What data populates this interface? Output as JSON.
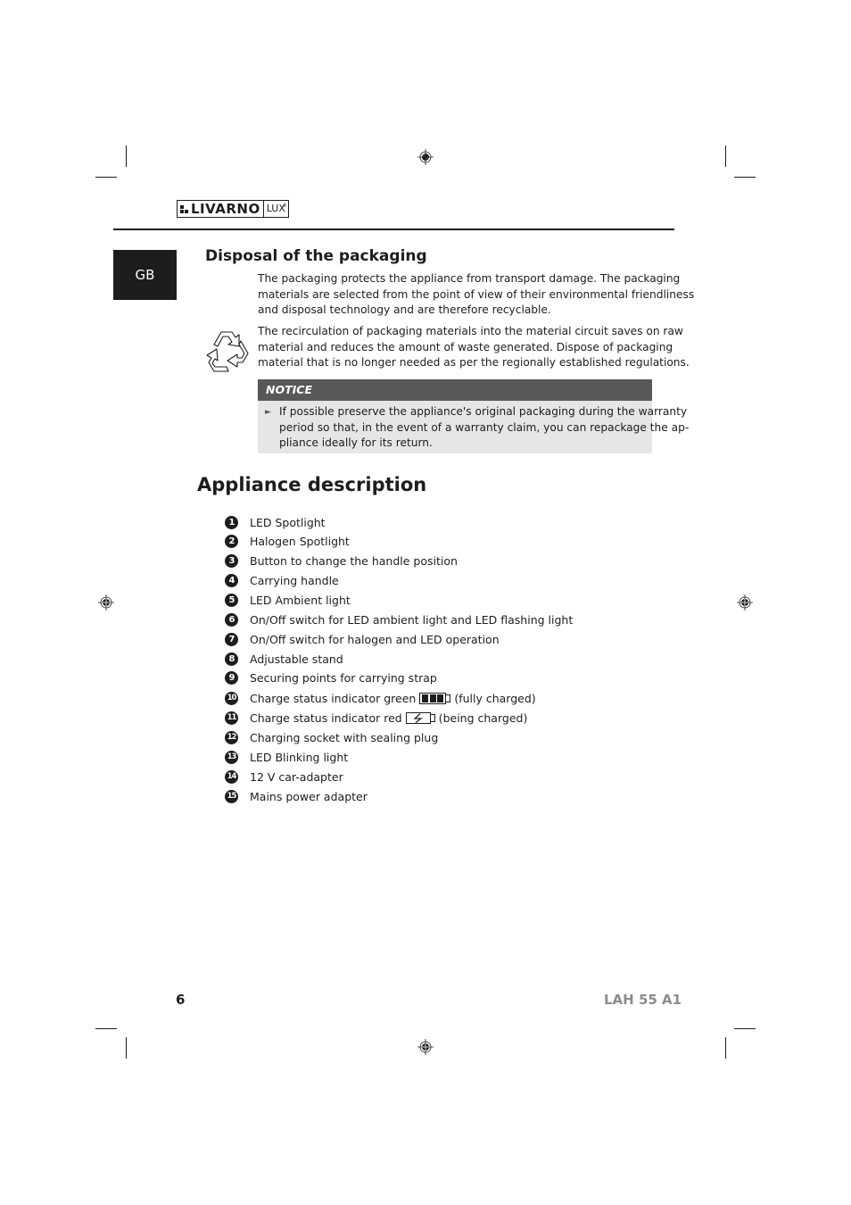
{
  "header": {
    "brand": "LIVARNO",
    "brand_sub": "LUX",
    "brand_reg": "®",
    "language_tab": "GB"
  },
  "disposal": {
    "title": "Disposal of the packaging",
    "paragraph1": [
      "The packaging protects the appliance from transport damage. The packaging",
      "materials are selected from the point of view of their environmental friendliness",
      "and disposal technology and are therefore recyclable."
    ],
    "paragraph2": [
      "The recirculation of packaging materials into the material circuit saves on raw",
      "material and reduces the amount of waste generated. Dispose of packaging",
      "material that is no longer needed as per the regionally established regulations."
    ],
    "icon": "recycle-icon",
    "notice": {
      "title": "NOTICE",
      "bullet_icon": "arrow-right-icon",
      "lines": [
        "If possible preserve the appliance's original packaging during the warranty",
        "period so that, in the event of a warranty claim, you can repackage the ap-",
        "pliance ideally for its return."
      ]
    }
  },
  "appliance": {
    "title": "Appliance description",
    "parts": [
      {
        "num": "1",
        "label": "LED Spotlight"
      },
      {
        "num": "2",
        "label": "Halogen Spotlight"
      },
      {
        "num": "3",
        "label": "Button to change the handle position"
      },
      {
        "num": "4",
        "label": "Carrying handle"
      },
      {
        "num": "5",
        "label": "LED Ambient light"
      },
      {
        "num": "6",
        "label": "On/Off switch for LED ambient light and LED flashing light"
      },
      {
        "num": "7",
        "label": "On/Off switch for halogen and LED operation"
      },
      {
        "num": "8",
        "label": "Adjustable stand"
      },
      {
        "num": "9",
        "label": "Securing points for carrying strap"
      },
      {
        "num": "10",
        "label": "Charge status indicator green",
        "icon": "battery-full-icon",
        "suffix": "(fully charged)"
      },
      {
        "num": "11",
        "label": "Charge status indicator red",
        "icon": "battery-charging-icon",
        "suffix": "(being charged)"
      },
      {
        "num": "12",
        "label": "Charging socket with sealing plug"
      },
      {
        "num": "13",
        "label": "LED Blinking light"
      },
      {
        "num": "14",
        "label": "12 V car-adapter"
      },
      {
        "num": "15",
        "label": "Mains power adapter"
      }
    ]
  },
  "footer": {
    "page_number": "6",
    "model": "LAH 55 A1"
  }
}
